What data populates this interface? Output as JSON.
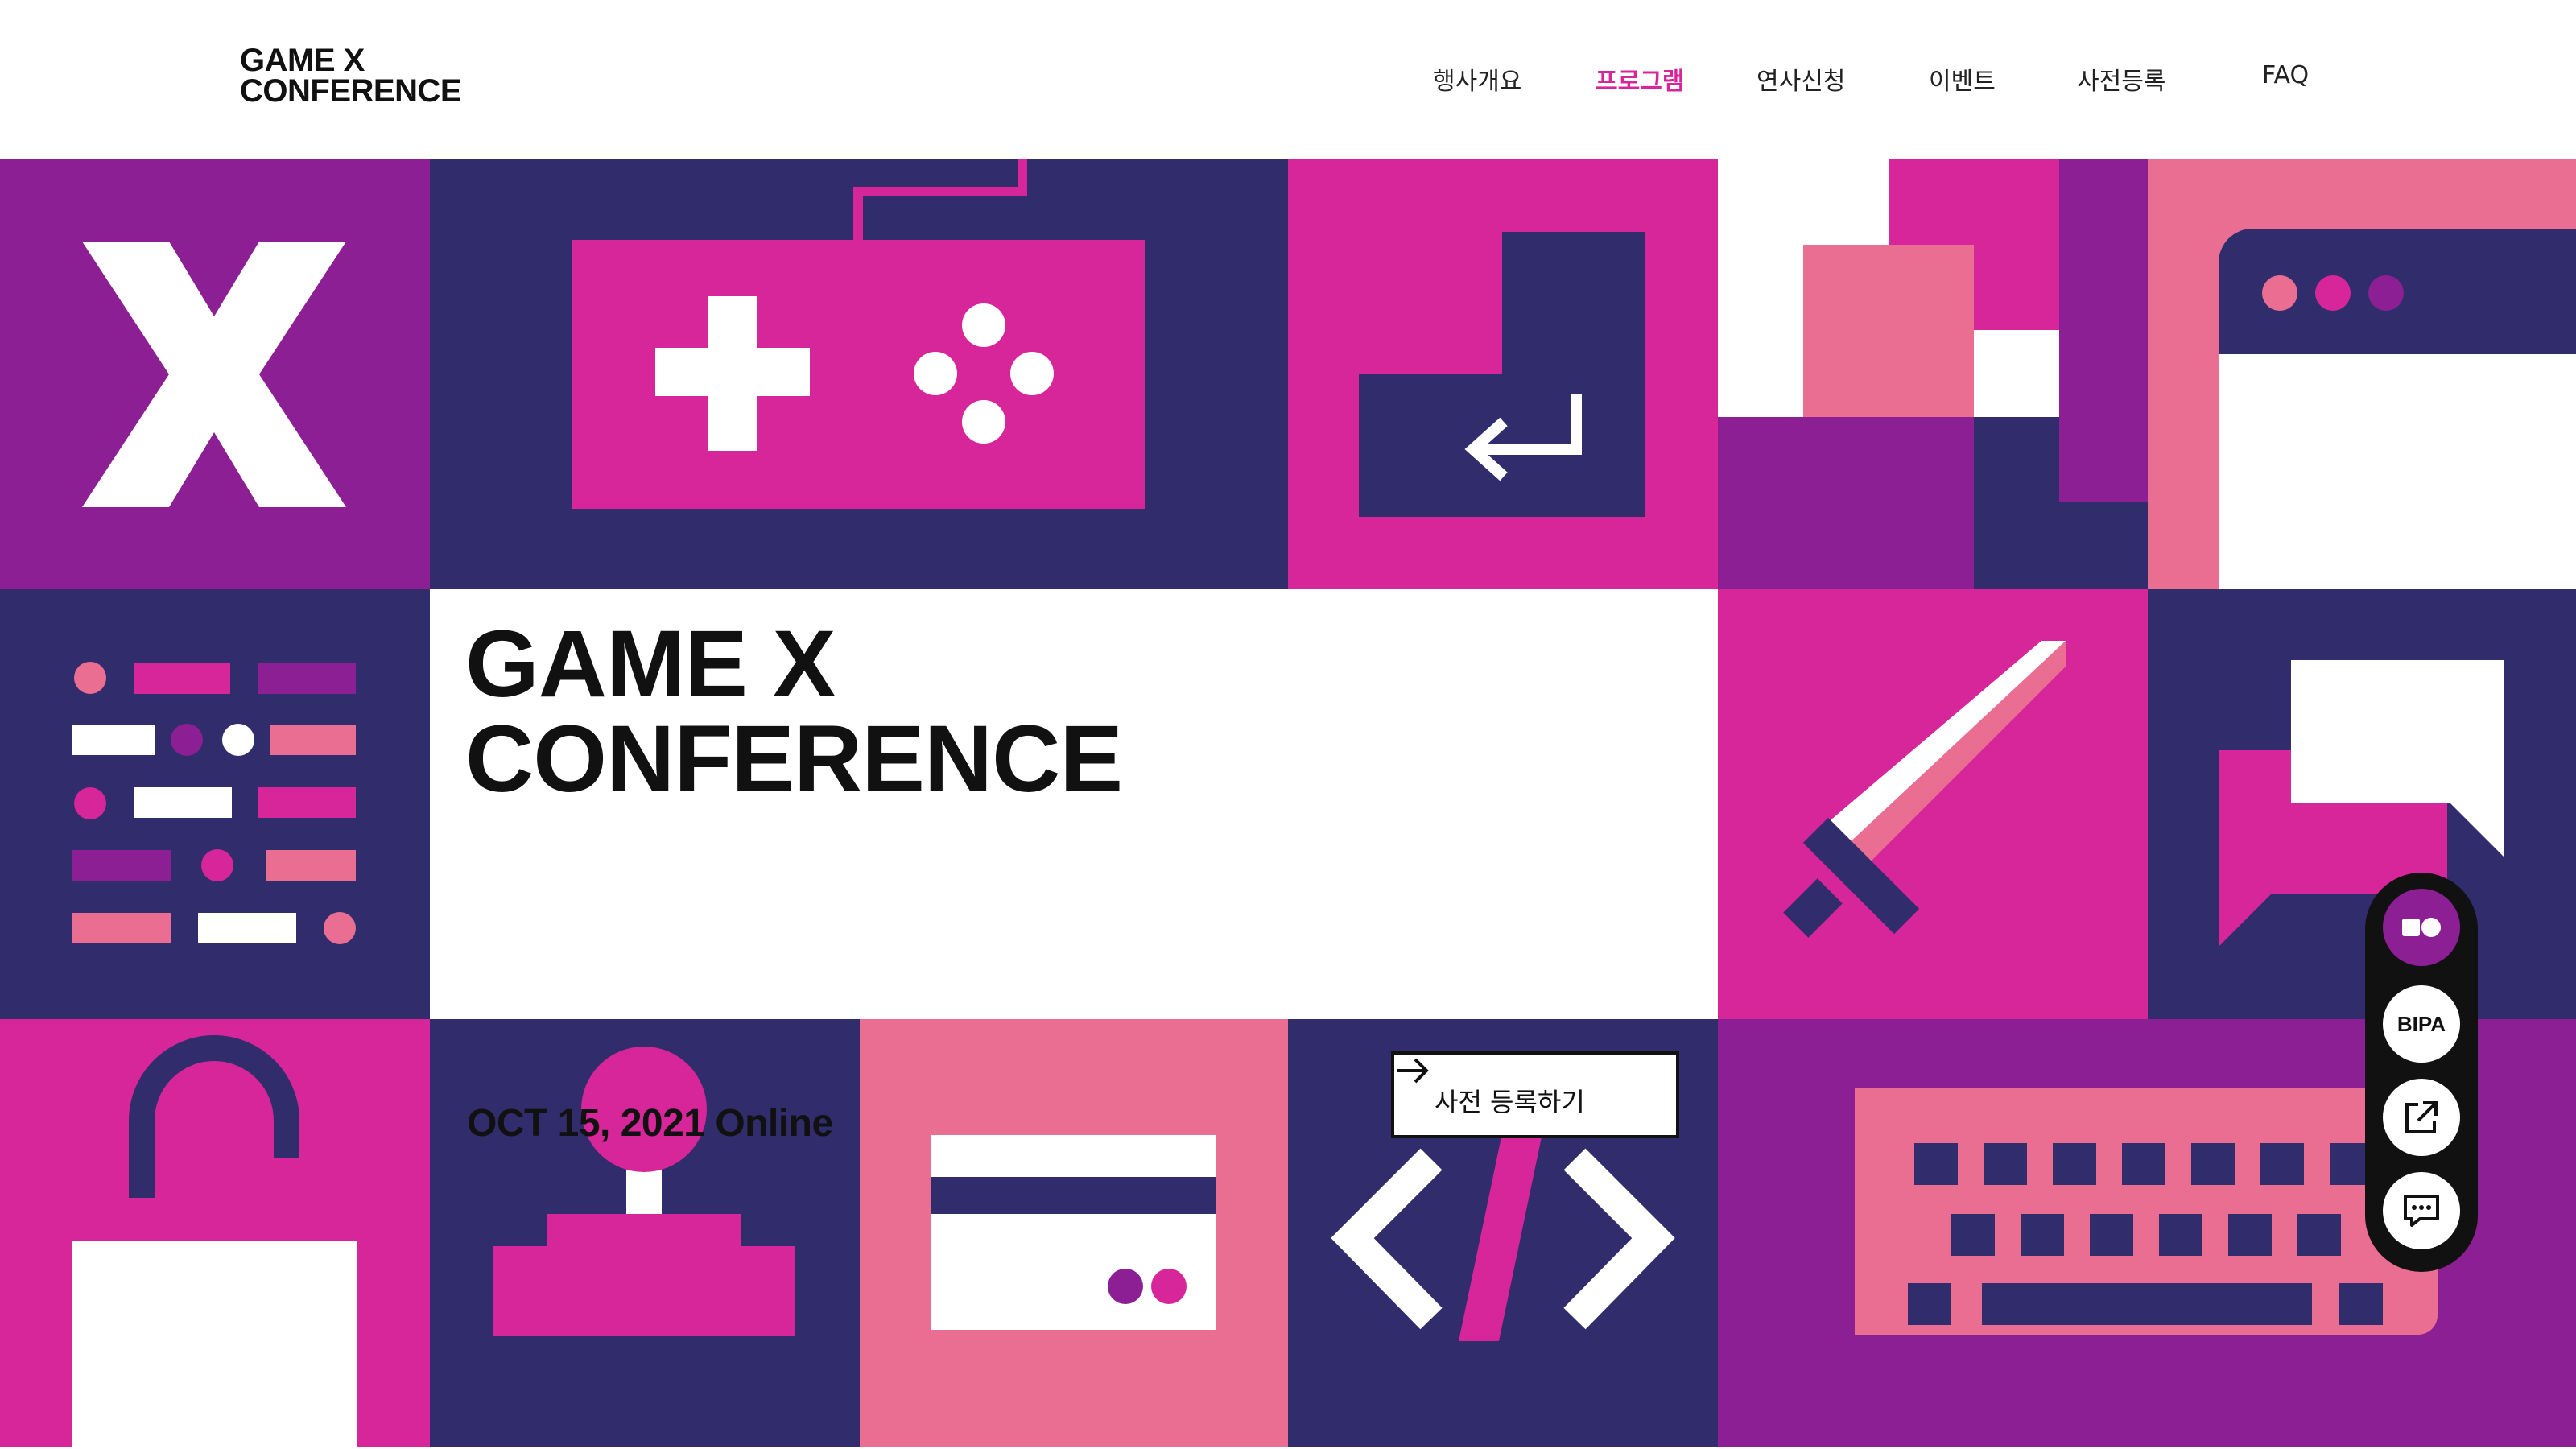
{
  "header": {
    "logo_line1": "GAME X",
    "logo_line2": "CONFERENCE",
    "nav": [
      {
        "label": "행사개요",
        "active": false
      },
      {
        "label": "프로그램",
        "active": true
      },
      {
        "label": "연사신청",
        "active": false
      },
      {
        "label": "이벤트",
        "active": false
      },
      {
        "label": "사전등록",
        "active": false
      },
      {
        "label": "FAQ",
        "active": false
      }
    ]
  },
  "hero": {
    "title_line1": "GAME X",
    "title_line2": "CONFERENCE",
    "date": "OCT 15, 2021 Online",
    "cta_label": "사전 등록하기"
  },
  "floating_menu": {
    "items": [
      {
        "name": "toggle-icon"
      },
      {
        "label": "BIPA"
      },
      {
        "name": "external-link-icon"
      },
      {
        "name": "chat-icon"
      }
    ]
  },
  "colors": {
    "purple": "#8b1f93",
    "navy": "#312c6b",
    "magenta": "#d6269a",
    "pink": "#ea6e91",
    "active_nav": "#d6269a"
  }
}
